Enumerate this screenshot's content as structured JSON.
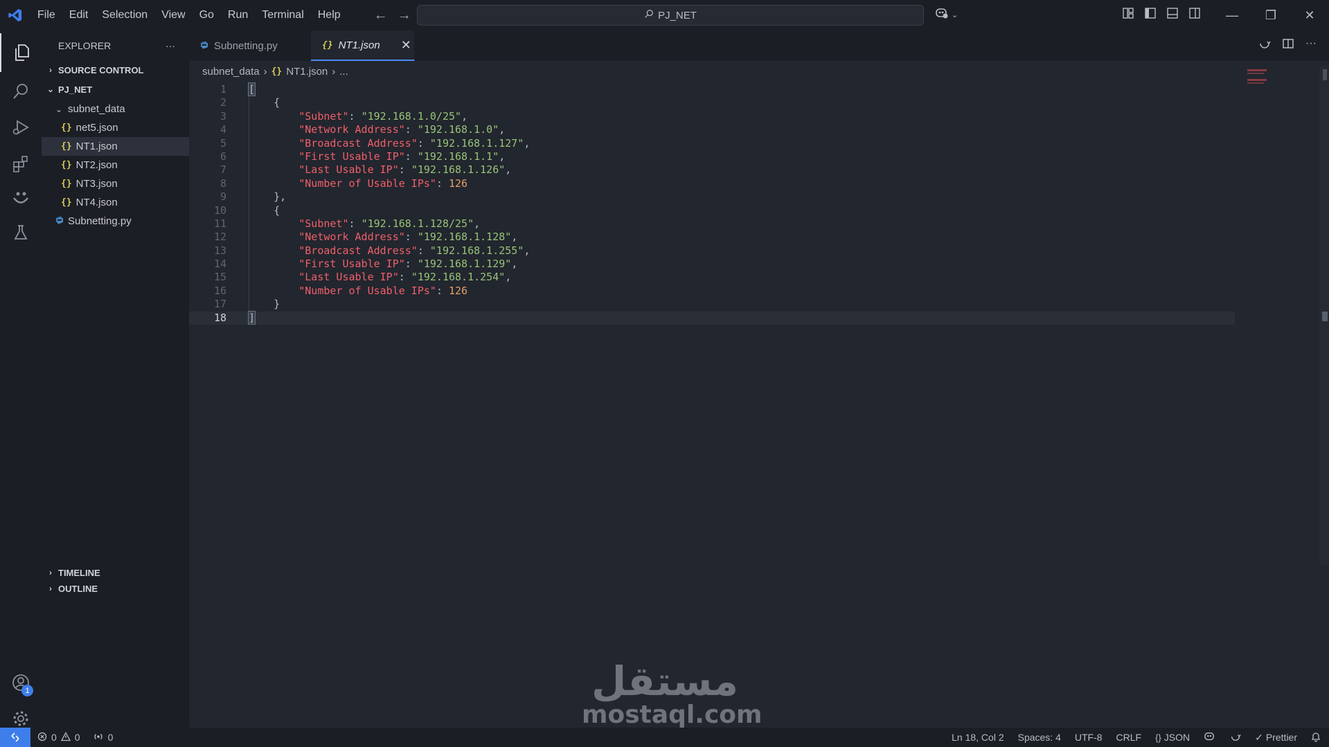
{
  "titlebar": {
    "menu": [
      "File",
      "Edit",
      "Selection",
      "View",
      "Go",
      "Run",
      "Terminal",
      "Help"
    ],
    "search_text": "PJ_NET"
  },
  "sidebar": {
    "title": "EXPLORER",
    "more_label": "···",
    "source_control": "SOURCE CONTROL",
    "project": "PJ_NET",
    "folder": "subnet_data",
    "files": [
      "net5.json",
      "NT1.json",
      "NT2.json",
      "NT3.json",
      "NT4.json"
    ],
    "py_file": "Subnetting.py",
    "timeline": "TIMELINE",
    "outline": "OUTLINE",
    "json_glyph": "{}"
  },
  "tabs": [
    {
      "label": "Subnetting.py"
    },
    {
      "label": "NT1.json"
    }
  ],
  "breadcrumb": {
    "folder": "subnet_data",
    "file": "NT1.json",
    "more": "..."
  },
  "editor": {
    "lines": [
      {
        "num": "1"
      },
      {
        "num": "2"
      },
      {
        "num": "3"
      },
      {
        "num": "4"
      },
      {
        "num": "5"
      },
      {
        "num": "6"
      },
      {
        "num": "7"
      },
      {
        "num": "8"
      },
      {
        "num": "9"
      },
      {
        "num": "10"
      },
      {
        "num": "11"
      },
      {
        "num": "12"
      },
      {
        "num": "13"
      },
      {
        "num": "14"
      },
      {
        "num": "15"
      },
      {
        "num": "16"
      },
      {
        "num": "17"
      },
      {
        "num": "18"
      }
    ],
    "keys": {
      "subnet": "\"Subnet\"",
      "network": "\"Network Address\"",
      "broadcast": "\"Broadcast Address\"",
      "first": "\"First Usable IP\"",
      "last": "\"Last Usable IP\"",
      "count": "\"Number of Usable IPs\""
    },
    "subnets": [
      {
        "subnet": "\"192.168.1.0/25\"",
        "network": "\"192.168.1.0\"",
        "broadcast": "\"192.168.1.127\"",
        "first": "\"192.168.1.1\"",
        "last": "\"192.168.1.126\"",
        "count": "126"
      },
      {
        "subnet": "\"192.168.1.128/25\"",
        "network": "\"192.168.1.128\"",
        "broadcast": "\"192.168.1.255\"",
        "first": "\"192.168.1.129\"",
        "last": "\"192.168.1.254\"",
        "count": "126"
      }
    ]
  },
  "watermark": {
    "arabic": "مستقل",
    "latin": "mostaql.com"
  },
  "statusbar": {
    "errors": "0",
    "warnings": "0",
    "ports": "0",
    "position": "Ln 18, Col 2",
    "spaces": "Spaces: 4",
    "encoding": "UTF-8",
    "eol": "CRLF",
    "language": "JSON",
    "formatter": "Prettier"
  },
  "account_badge": "1",
  "colors": {
    "accent": "#3d7eea",
    "key": "#ef5f6b",
    "string": "#98c379",
    "number": "#e5a068",
    "json_icon": "#d7c95a"
  }
}
